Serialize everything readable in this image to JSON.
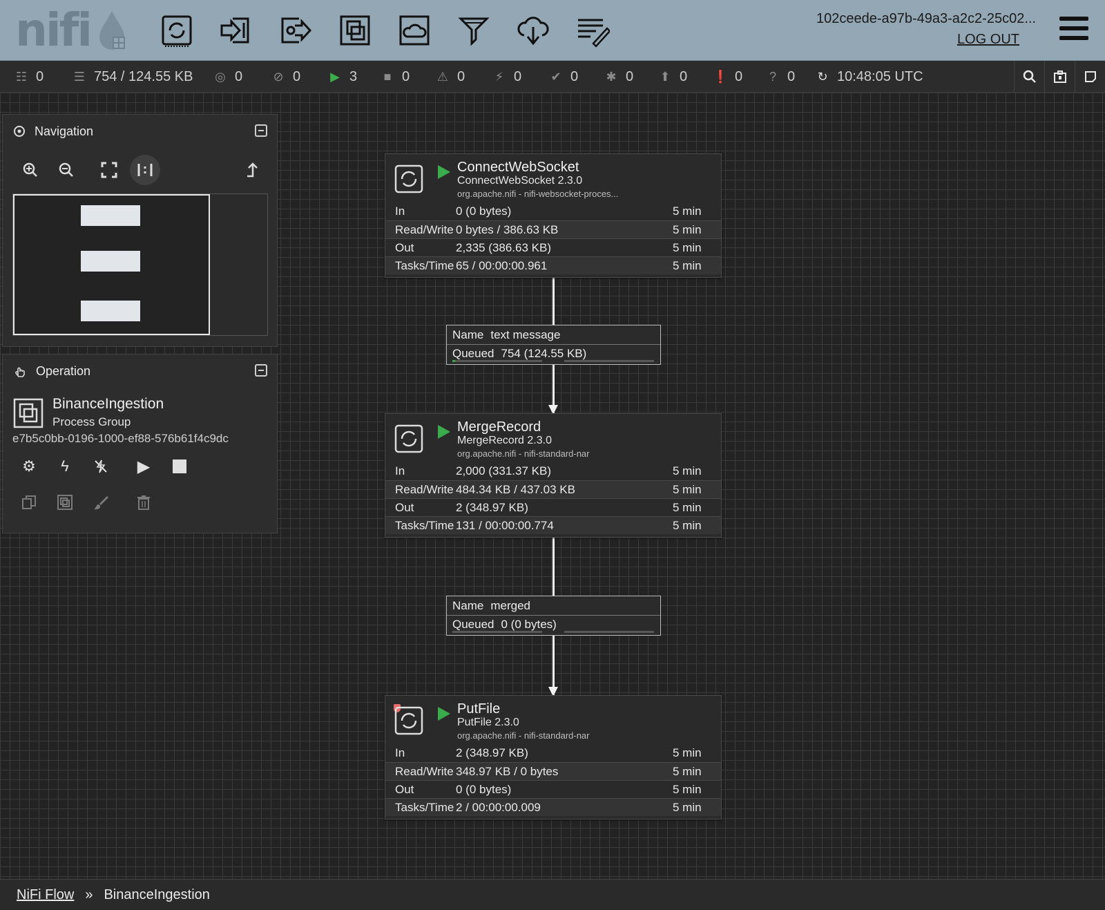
{
  "header": {
    "logo_text": "nifi",
    "user_id": "102ceede-a97b-49a3-a2c2-25c02...",
    "logout_label": "LOG OUT",
    "tools": [
      {
        "name": "processor-tool",
        "icon": "processor-icon"
      },
      {
        "name": "input-port-tool",
        "icon": "input-port-icon"
      },
      {
        "name": "output-port-tool",
        "icon": "output-port-icon"
      },
      {
        "name": "process-group-tool",
        "icon": "process-group-icon"
      },
      {
        "name": "remote-process-group-tool",
        "icon": "remote-process-group-icon"
      },
      {
        "name": "funnel-tool",
        "icon": "funnel-icon"
      },
      {
        "name": "template-tool",
        "icon": "cloud-download-icon"
      },
      {
        "name": "label-tool",
        "icon": "label-icon"
      }
    ]
  },
  "status": {
    "transmitting": "0",
    "queued": "754 / 124.55 KB",
    "transmitting_ports": "0",
    "not_transmitting": "0",
    "running": "3",
    "stopped": "0",
    "invalid": "0",
    "disabled": "0",
    "up_to_date": "0",
    "locally_modified": "0",
    "stale": "0",
    "locally_modified_stale": "0",
    "sync_failure": "0",
    "last_refreshed": "10:48:05 UTC"
  },
  "navigation": {
    "title": "Navigation"
  },
  "operation": {
    "title": "Operation",
    "name": "BinanceIngestion",
    "type": "Process Group",
    "id": "e7b5c0bb-0196-1000-ef88-576b61f4c9dc"
  },
  "processors": [
    {
      "name": "ConnectWebSocket",
      "type": "ConnectWebSocket 2.3.0",
      "bundle": "org.apache.nifi - nifi-websocket-proces...",
      "in": "0 (0 bytes)",
      "read_write": "0 bytes / 386.63 KB",
      "out": "2,335 (386.63 KB)",
      "tasks_time": "65 / 00:00:00.961",
      "window": "5 min"
    },
    {
      "name": "MergeRecord",
      "type": "MergeRecord 2.3.0",
      "bundle": "org.apache.nifi - nifi-standard-nar",
      "in": "2,000 (331.37 KB)",
      "read_write": "484.34 KB / 437.03 KB",
      "out": "2 (348.97 KB)",
      "tasks_time": "131 / 00:00:00.774",
      "window": "5 min"
    },
    {
      "name": "PutFile",
      "type": "PutFile 2.3.0",
      "bundle": "org.apache.nifi - nifi-standard-nar",
      "in": "2 (348.97 KB)",
      "read_write": "348.97 KB / 0 bytes",
      "out": "0 (0 bytes)",
      "tasks_time": "2 / 00:00:00.009",
      "window": "5 min"
    }
  ],
  "row_labels": {
    "in": "In",
    "read_write": "Read/Write",
    "out": "Out",
    "tasks_time": "Tasks/Time"
  },
  "connections": [
    {
      "name_label": "Name",
      "name": "text message",
      "queued_label": "Queued",
      "queued": "754 (124.55 KB)",
      "fill_fraction": 0.03
    },
    {
      "name_label": "Name",
      "name": "merged",
      "queued_label": "Queued",
      "queued": "0 (0 bytes)",
      "fill_fraction": 0
    }
  ],
  "breadcrumb": {
    "root": "NiFi Flow",
    "separator": "»",
    "current": "BinanceIngestion"
  },
  "colors": {
    "header_bg": "#94a7b4",
    "running_green": "#3cab4c",
    "canvas_bg": "#232323"
  }
}
